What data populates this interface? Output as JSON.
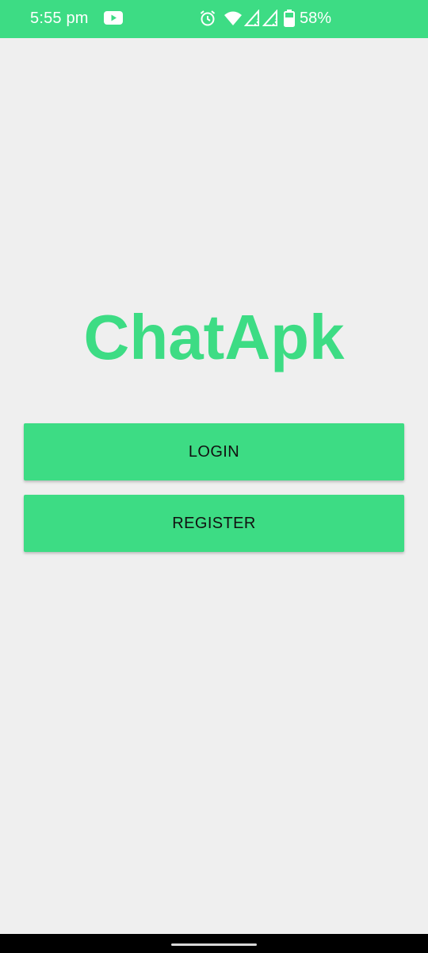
{
  "status_bar": {
    "time": "5:55 pm",
    "battery_percent": "58%",
    "icons": [
      "youtube-icon",
      "alarm-icon",
      "wifi-icon",
      "signal-no-service-icon",
      "signal-no-service-icon",
      "battery-icon"
    ],
    "background_color": "#3ddc84"
  },
  "main": {
    "app_title": "ChatApk",
    "login_label": "LOGIN",
    "register_label": "REGISTER",
    "accent_color": "#3ddc84"
  },
  "navigation": {
    "home_handle": "gesture-bar"
  }
}
